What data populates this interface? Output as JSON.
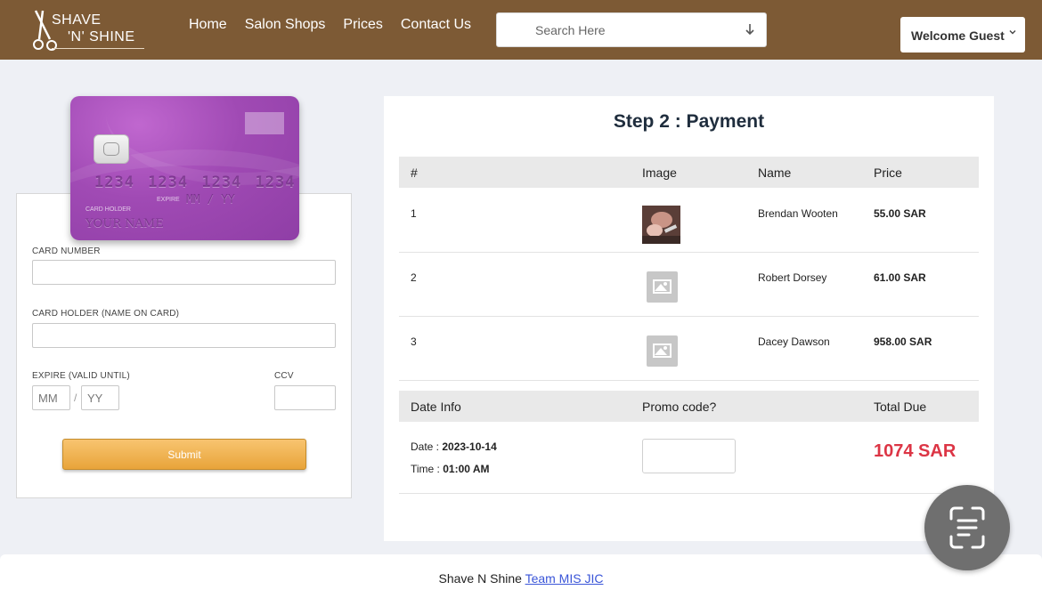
{
  "header": {
    "logo": {
      "line1": "SHAVE",
      "line2": "'N' SHINE"
    },
    "nav": [
      "Home",
      "Salon Shops",
      "Prices",
      "Contact Us"
    ],
    "search": {
      "placeholder": "Search Here",
      "value": ""
    },
    "user_menu": {
      "label": "Welcome Guest"
    }
  },
  "card_preview": {
    "number": "1234 1234 1234 1234",
    "expire_label": "EXPIRE",
    "expire_value": "MM / YY",
    "holder_label": "CARD HOLDER",
    "holder_value": "YOUR NAME"
  },
  "card_form": {
    "card_number_label": "CARD NUMBER",
    "card_number_value": "",
    "holder_label": "CARD HOLDER (NAME ON CARD)",
    "holder_value": "",
    "expire_label": "EXPIRE (VALID UNTIL)",
    "month_placeholder": "MM",
    "year_placeholder": "YY",
    "date_separator": "/",
    "ccv_label": "CCV",
    "ccv_value": "",
    "submit_label": "Submit"
  },
  "payment": {
    "title": "Step 2 : Payment",
    "columns": [
      "#",
      "Image",
      "Name",
      "Price"
    ],
    "rows": [
      {
        "index": "1",
        "name": "Brendan Wooten",
        "price": "55.00 SAR",
        "image": "photo"
      },
      {
        "index": "2",
        "name": "Robert Dorsey",
        "price": "61.00 SAR",
        "image": "image-placeholder-icon"
      },
      {
        "index": "3",
        "name": "Dacey Dawson",
        "price": "958.00 SAR",
        "image": "image-placeholder-icon"
      }
    ],
    "summary_columns": [
      "Date Info",
      "Promo code?",
      "Total Due"
    ],
    "date_label": "Date :",
    "date_value": "2023-10-14",
    "time_label": "Time :",
    "time_value": "01:00 AM",
    "promo_value": "",
    "total_due": "1074 SAR"
  },
  "footer": {
    "text": "Shave N Shine",
    "link": "Team MIS JIC"
  },
  "colors": {
    "header_bg": "#7d5a35",
    "total_red": "#dc3545",
    "submit_orange": "#e8a43a",
    "card_purple": "#a04ab4",
    "link_blue": "#3a55d8"
  }
}
